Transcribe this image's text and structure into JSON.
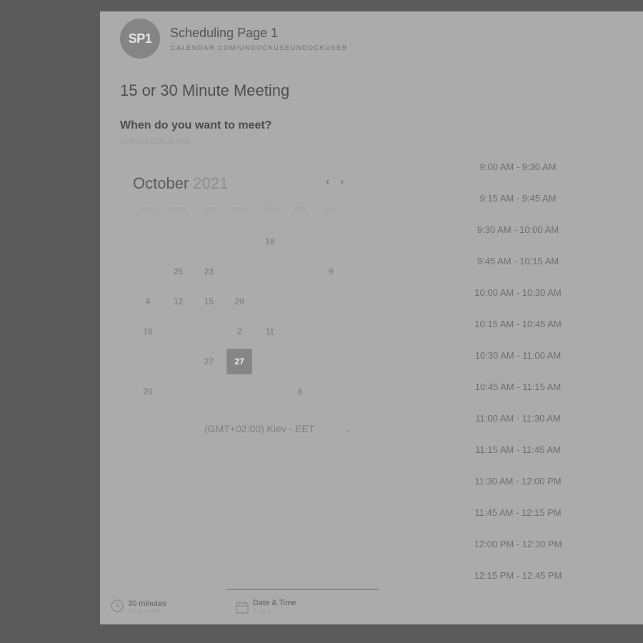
{
  "header": {
    "avatar_text": "SP1",
    "page_name": "Scheduling Page 1",
    "page_url": "CALENDAR.COM/UNDOCKUSEUNDOCKUSER"
  },
  "meeting": {
    "title": "15 or 30 Minute Meeting",
    "prompt": "When do you want to meet?",
    "subprompt": "Select a date & time"
  },
  "calendar": {
    "month": "October",
    "year": "2021",
    "prev_icon": "chevron-left-icon",
    "next_icon": "chevron-right-icon",
    "weekdays": [
      "SUN",
      "MON",
      "TUE",
      "WED",
      "THU",
      "FRI",
      "SAT"
    ],
    "days": [
      {
        "label": "18",
        "row": 0,
        "col": 4
      },
      {
        "label": "25",
        "row": 1,
        "col": 1
      },
      {
        "label": "23",
        "row": 1,
        "col": 2
      },
      {
        "label": "9",
        "row": 1,
        "col": 6
      },
      {
        "label": "4",
        "row": 2,
        "col": 0
      },
      {
        "label": "12",
        "row": 2,
        "col": 1
      },
      {
        "label": "15",
        "row": 2,
        "col": 2
      },
      {
        "label": "29",
        "row": 2,
        "col": 3
      },
      {
        "label": "16",
        "row": 3,
        "col": 0
      },
      {
        "label": "2",
        "row": 3,
        "col": 3
      },
      {
        "label": "11",
        "row": 3,
        "col": 4
      },
      {
        "label": "27",
        "row": 4,
        "col": 2
      },
      {
        "label": "27",
        "row": 4,
        "col": 3,
        "selected": true
      },
      {
        "label": "20",
        "row": 5,
        "col": 0
      },
      {
        "label": "6",
        "row": 5,
        "col": 5
      }
    ]
  },
  "timezone": {
    "label": "(GMT+02:00) Kiev - EET",
    "icon": "chevron-down-icon"
  },
  "time_slots": [
    "9:00 AM - 9:30 AM",
    "9:15 AM - 9:45 AM",
    "9:30 AM - 10:00 AM",
    "9:45 AM - 10:15 AM",
    "10:00 AM - 10:30 AM",
    "10:15 AM - 10:45 AM",
    "10:30 AM - 11:00 AM",
    "10:45 AM - 11:15 AM",
    "11:00 AM - 11:30 AM",
    "11:15 AM - 11:45 AM",
    "11:30 AM - 12:00 PM",
    "11:45 AM - 12:15 PM",
    "12:00 PM - 12:30 PM",
    "12:15 PM - 12:45 PM"
  ],
  "footer": {
    "duration": {
      "label": "30 minutes",
      "sub": "HOW LONG",
      "icon": "clock-icon"
    },
    "datetime": {
      "label": "Date & Time",
      "sub": "WHEN",
      "icon": "calendar-icon"
    }
  }
}
